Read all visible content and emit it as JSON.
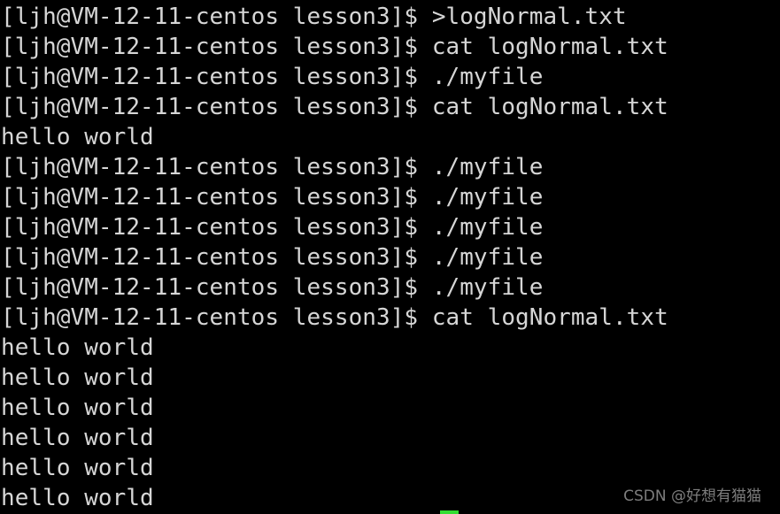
{
  "terminal": {
    "background_color": "#000000",
    "foreground_color": "#d6d6d6",
    "prompt": "[ljh@VM-12-11-centos lesson3]$ ",
    "cursor": {
      "color": "#33dd33",
      "label": "text-cursor"
    },
    "lines": [
      {
        "type": "prompt",
        "prompt": "[ljh@VM-12-11-centos lesson3]$ ",
        "command": ">logNormal.txt"
      },
      {
        "type": "prompt",
        "prompt": "[ljh@VM-12-11-centos lesson3]$ ",
        "command": "cat logNormal.txt"
      },
      {
        "type": "prompt",
        "prompt": "[ljh@VM-12-11-centos lesson3]$ ",
        "command": "./myfile"
      },
      {
        "type": "prompt",
        "prompt": "[ljh@VM-12-11-centos lesson3]$ ",
        "command": "cat logNormal.txt"
      },
      {
        "type": "output",
        "text": "hello world"
      },
      {
        "type": "prompt",
        "prompt": "[ljh@VM-12-11-centos lesson3]$ ",
        "command": "./myfile"
      },
      {
        "type": "prompt",
        "prompt": "[ljh@VM-12-11-centos lesson3]$ ",
        "command": "./myfile"
      },
      {
        "type": "prompt",
        "prompt": "[ljh@VM-12-11-centos lesson3]$ ",
        "command": "./myfile"
      },
      {
        "type": "prompt",
        "prompt": "[ljh@VM-12-11-centos lesson3]$ ",
        "command": "./myfile"
      },
      {
        "type": "prompt",
        "prompt": "[ljh@VM-12-11-centos lesson3]$ ",
        "command": "./myfile"
      },
      {
        "type": "prompt",
        "prompt": "[ljh@VM-12-11-centos lesson3]$ ",
        "command": "cat logNormal.txt"
      },
      {
        "type": "output",
        "text": "hello world"
      },
      {
        "type": "output",
        "text": "hello world"
      },
      {
        "type": "output",
        "text": "hello world"
      },
      {
        "type": "output",
        "text": "hello world"
      },
      {
        "type": "output",
        "text": "hello world"
      },
      {
        "type": "output",
        "text": "hello world"
      }
    ]
  },
  "watermark": {
    "text": "CSDN @好想有猫猫",
    "color": "#7d7d7d"
  }
}
